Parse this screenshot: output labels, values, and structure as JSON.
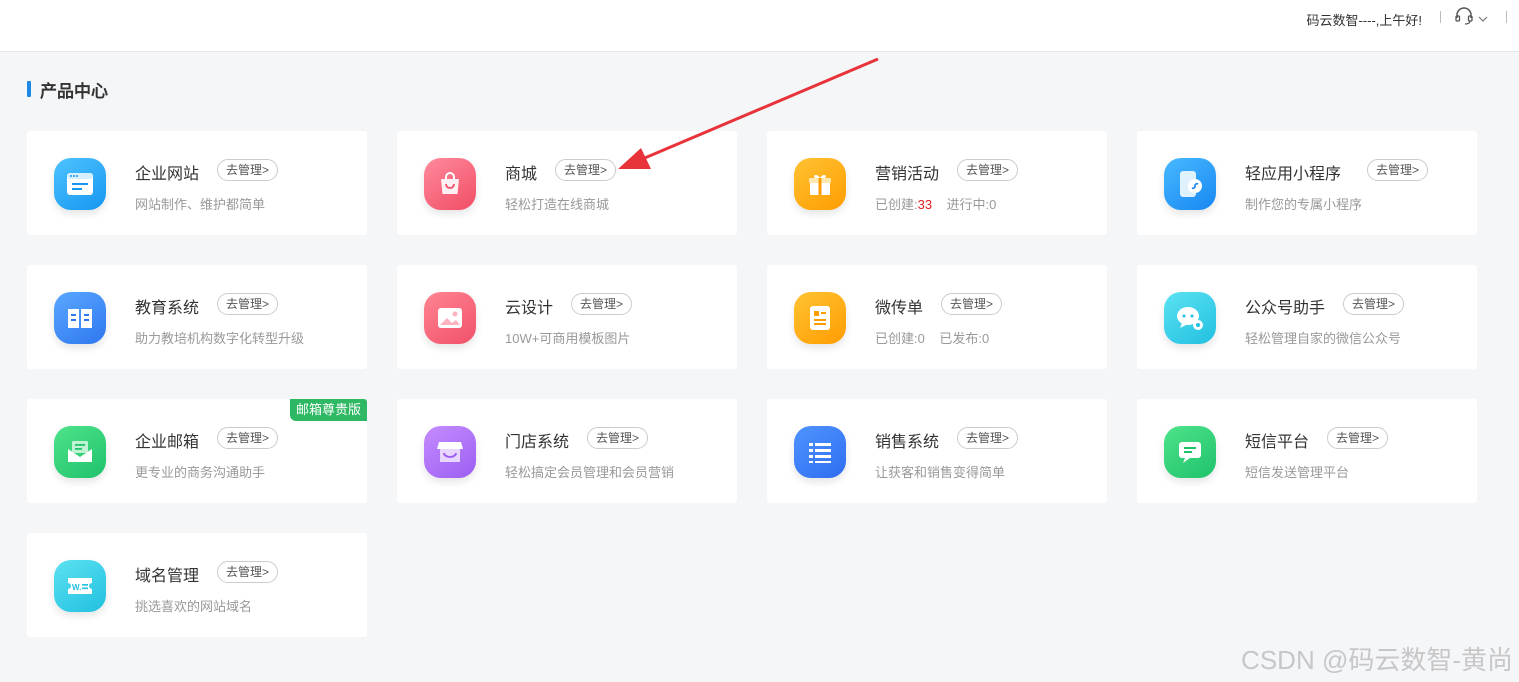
{
  "header": {
    "greeting": "码云数智----,上午好!",
    "support_icon": "headset-icon",
    "dropdown_icon": "chevron-down-icon"
  },
  "section": {
    "title": "产品中心"
  },
  "manage_label": "去管理>",
  "cards": [
    {
      "name": "企业网站",
      "desc": "网站制作、维护都简单",
      "icon": "browser-window-icon",
      "color": "#1596f0"
    },
    {
      "name": "商城",
      "desc": "轻松打造在线商城",
      "icon": "shopping-bag-icon",
      "color": "#f14d65"
    },
    {
      "name": "营销活动",
      "desc_created_label": "已创建:",
      "desc_created_value": "33",
      "desc_running_label": "进行中:",
      "desc_running_value": "0",
      "icon": "gift-icon",
      "color": "#ff9d00"
    },
    {
      "name": "轻应用小程序",
      "desc": "制作您的专属小程序",
      "icon": "mini-program-phone-icon",
      "color": "#1787f2"
    },
    {
      "name": "教育系统",
      "desc": "助力教培机构数字化转型升级",
      "icon": "open-book-icon",
      "color": "#2e77f0"
    },
    {
      "name": "云设计",
      "desc": "10W+可商用模板图片",
      "icon": "image-picture-icon",
      "color": "#f1506a"
    },
    {
      "name": "微传单",
      "desc_created_label": "已创建:",
      "desc_created_value": "0",
      "desc_published_label": "已发布:",
      "desc_published_value": "0",
      "icon": "flyer-document-icon",
      "color": "#ff9d00"
    },
    {
      "name": "公众号助手",
      "desc": "轻松管理自家的微信公众号",
      "icon": "chat-bubble-gear-icon",
      "color": "#21c0e0"
    },
    {
      "name": "企业邮箱",
      "desc": "更专业的商务沟通助手",
      "badge": "邮箱尊贵版",
      "icon": "envelope-icon",
      "color": "#1fc26b"
    },
    {
      "name": "门店系统",
      "desc": "轻松搞定会员管理和会员营销",
      "icon": "storefront-icon",
      "color": "#9b5ef2"
    },
    {
      "name": "销售系统",
      "desc": "让获客和销售变得简单",
      "icon": "list-icon",
      "color": "#2f6ef0"
    },
    {
      "name": "短信平台",
      "desc": "短信发送管理平台",
      "icon": "message-bubble-icon",
      "color": "#1fc26b"
    },
    {
      "name": "域名管理",
      "desc": "挑选喜欢的网站域名",
      "icon": "domain-www-icon",
      "color": "#21c0e0"
    }
  ],
  "watermark": "CSDN @码云数智-黄尚"
}
